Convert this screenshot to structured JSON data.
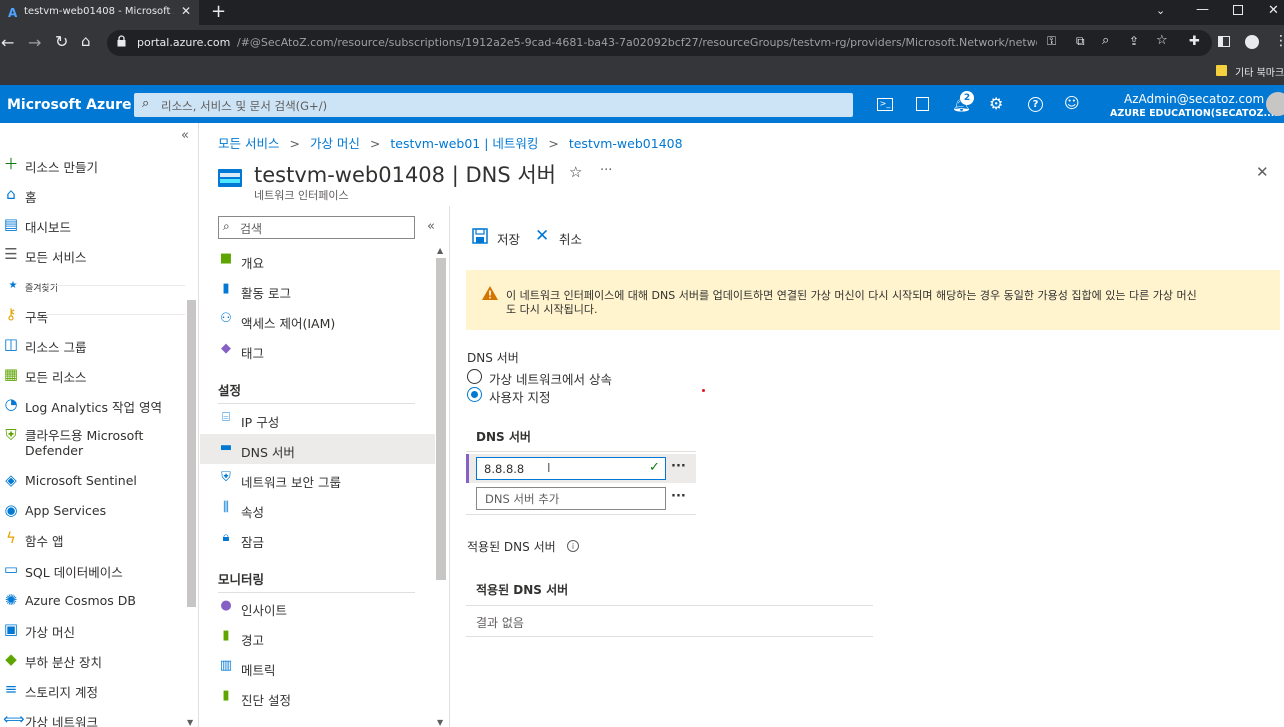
{
  "browser": {
    "tab_title": "testvm-web01408 - Microsoft A",
    "new_tab_label": "+",
    "url_host": "portal.azure.com",
    "url_path": "/#@SecAtoZ.com/resource/subscriptions/1912a2e5-9cad-4681-ba43-7a02092bcf27/resourceGroups/testvm-rg/providers/Microsoft.Network/networ...",
    "bookmark_folder": "기타 북마크"
  },
  "header": {
    "brand": "Microsoft Azure",
    "search_placeholder": "리소스, 서비스 및 문서 검색(G+/)",
    "notification_count": "2",
    "account_email": "AzAdmin@secatoz.com",
    "account_tenant": "AZURE EDUCATION(SECATOZ....",
    "colors": {
      "header_bg": "#0078d4",
      "accent": "#0078d4",
      "warning_bg": "#fff4ce"
    }
  },
  "sidebar": {
    "collapse_glyph": "«",
    "items": [
      {
        "label": "리소스 만들기",
        "icon": "plus-icon"
      },
      {
        "label": "홈",
        "icon": "home-icon"
      },
      {
        "label": "대시보드",
        "icon": "dashboard-icon"
      },
      {
        "label": "모든 서비스",
        "icon": "list-icon"
      },
      {
        "label": "즐겨찾기",
        "icon": "star-icon"
      },
      {
        "label": "구독",
        "icon": "key-icon"
      },
      {
        "label": "리소스 그룹",
        "icon": "resource-group-icon"
      },
      {
        "label": "모든 리소스",
        "icon": "grid-icon"
      },
      {
        "label": "Log Analytics 작업 영역",
        "icon": "log-analytics-icon"
      },
      {
        "label": "클라우드용 Microsoft Defender",
        "icon": "shield-icon"
      },
      {
        "label": "Microsoft Sentinel",
        "icon": "sentinel-icon"
      },
      {
        "label": "App Services",
        "icon": "globe-icon"
      },
      {
        "label": "함수 앱",
        "icon": "function-icon"
      },
      {
        "label": "SQL 데이터베이스",
        "icon": "sql-icon"
      },
      {
        "label": "Azure Cosmos DB",
        "icon": "cosmos-icon"
      },
      {
        "label": "가상 머신",
        "icon": "vm-icon"
      },
      {
        "label": "부하 분산 장치",
        "icon": "load-balancer-icon"
      },
      {
        "label": "스토리지 계정",
        "icon": "storage-icon"
      },
      {
        "label": "가상 네트워크",
        "icon": "vnet-icon"
      }
    ]
  },
  "breadcrumb": [
    "모든 서비스",
    "가상 머신",
    "testvm-web01 | 네트워킹",
    "testvm-web01408"
  ],
  "page": {
    "title": "testvm-web01408 | DNS 서버",
    "subtitle": "네트워크 인터페이스",
    "more_glyph": "···",
    "close_glyph": "✕"
  },
  "blade_menu": {
    "search_placeholder": "검색",
    "collapse_glyph": "«",
    "items_top": [
      {
        "label": "개요",
        "icon": "overview-icon"
      },
      {
        "label": "활동 로그",
        "icon": "activity-log-icon"
      },
      {
        "label": "액세스 제어(IAM)",
        "icon": "iam-icon"
      },
      {
        "label": "태그",
        "icon": "tag-icon"
      }
    ],
    "section_settings": "설정",
    "items_settings": [
      {
        "label": "IP 구성",
        "icon": "ip-config-icon"
      },
      {
        "label": "DNS 서버",
        "icon": "dns-icon"
      },
      {
        "label": "네트워크 보안 그룹",
        "icon": "nsg-icon"
      },
      {
        "label": "속성",
        "icon": "properties-icon"
      },
      {
        "label": "잠금",
        "icon": "lock-icon"
      }
    ],
    "section_monitoring": "모니터링",
    "items_monitoring": [
      {
        "label": "인사이트",
        "icon": "insights-icon"
      },
      {
        "label": "경고",
        "icon": "alerts-icon"
      },
      {
        "label": "메트릭",
        "icon": "metrics-icon"
      },
      {
        "label": "진단 설정",
        "icon": "diagnostic-icon"
      }
    ]
  },
  "toolbar": {
    "save_label": "저장",
    "cancel_label": "취소"
  },
  "warning": {
    "text_line1": "이 네트워크 인터페이스에 대해 DNS 서버를 업데이트하면 연결된 가상 머신이 다시 시작되며 해당하는 경우 동일한 가용성 집합에 있는 다른 가상 머신",
    "text_line2": "도 다시 시작됩니다."
  },
  "dns": {
    "group_label": "DNS 서버",
    "option_inherit": "가상 네트워크에서 상속",
    "option_custom": "사용자 지정",
    "selected": "사용자 지정",
    "list_header": "DNS 서버",
    "server_value": "8.8.8.8",
    "add_placeholder": "DNS 서버 추가",
    "row_more": "···"
  },
  "applied": {
    "section_label": "적용된 DNS 서버",
    "table_header": "적용된 DNS 서버",
    "empty_text": "결과 없음"
  }
}
